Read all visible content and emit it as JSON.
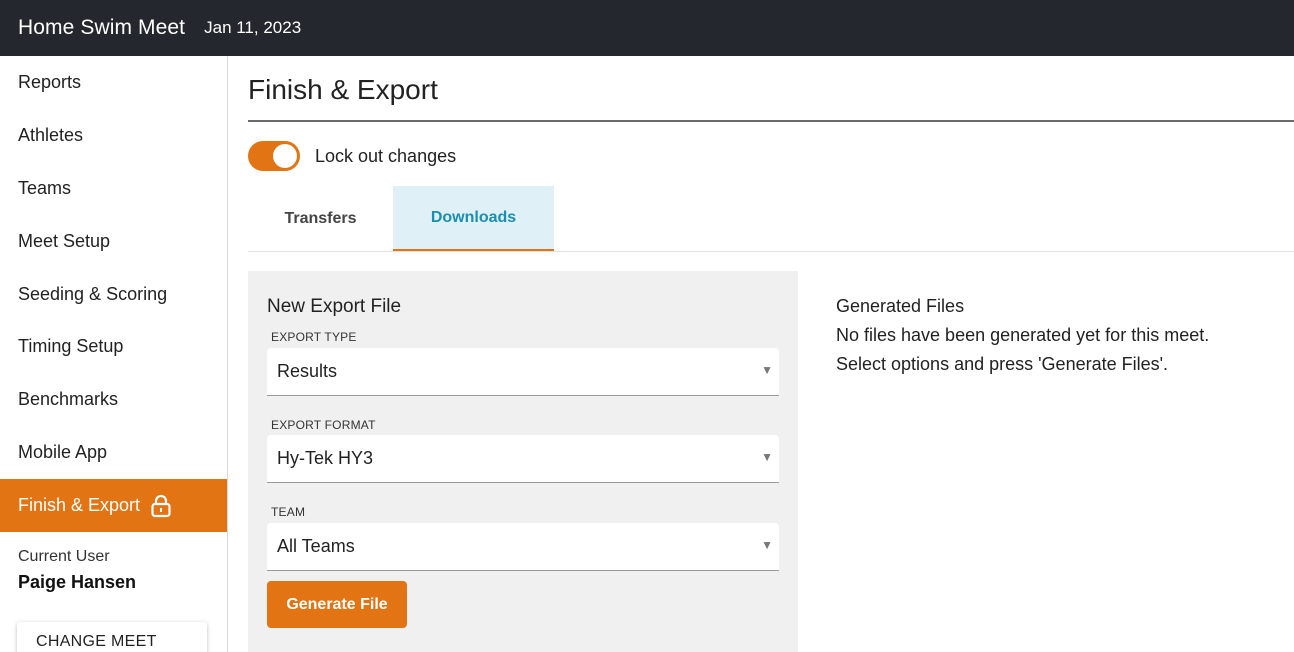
{
  "header": {
    "app_title": "Home Swim Meet",
    "meet_date": "Jan 11, 2023"
  },
  "sidebar": {
    "items": [
      {
        "label": "Reports"
      },
      {
        "label": "Athletes"
      },
      {
        "label": "Teams"
      },
      {
        "label": "Meet Setup"
      },
      {
        "label": "Seeding & Scoring"
      },
      {
        "label": "Timing Setup"
      },
      {
        "label": "Benchmarks"
      },
      {
        "label": "Mobile App"
      },
      {
        "label": "Finish & Export",
        "icon": "lock-icon",
        "active": true
      }
    ],
    "current_user_label": "Current User",
    "current_user_name": "Paige Hansen",
    "change_meet_label": "CHANGE MEET"
  },
  "main": {
    "page_title": "Finish & Export",
    "lock_toggle": {
      "label": "Lock out changes",
      "on": true
    },
    "tabs": [
      {
        "label": "Transfers",
        "active": false
      },
      {
        "label": "Downloads",
        "active": true
      }
    ],
    "export_form": {
      "title": "New Export File",
      "export_type": {
        "label": "EXPORT TYPE",
        "value": "Results"
      },
      "export_format": {
        "label": "EXPORT FORMAT",
        "value": "Hy-Tek HY3"
      },
      "team": {
        "label": "TEAM",
        "value": "All Teams"
      },
      "generate_button": "Generate File"
    },
    "generated_files": {
      "title": "Generated Files",
      "empty_message": "No files have been generated yet for this meet.",
      "hint": "Select options and press 'Generate Files'."
    }
  },
  "colors": {
    "accent": "#e37413",
    "topbar": "#24272e",
    "tab_active_bg": "#dff0f7",
    "tab_active_text": "#1a8fb1",
    "panel_bg": "#f0f0f0"
  }
}
